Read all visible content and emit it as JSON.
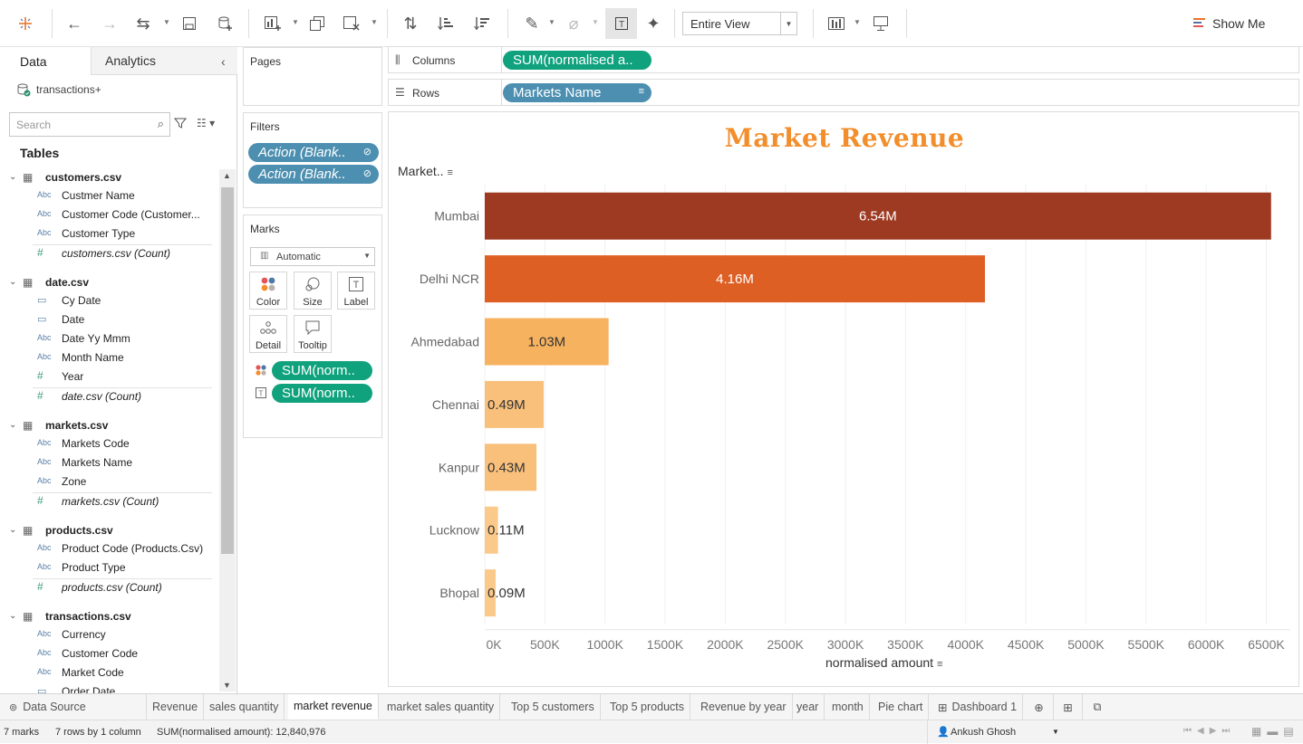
{
  "toolbar": {
    "fit": "Entire View",
    "show_me": "Show Me"
  },
  "data_pane": {
    "tabs": [
      "Data",
      "Analytics"
    ],
    "datasource": "transactions+",
    "search_placeholder": "Search",
    "tables_header": "Tables",
    "tables": [
      {
        "name": "customers.csv",
        "fields": [
          {
            "type": "Abc",
            "name": "Custmer Name"
          },
          {
            "type": "Abc",
            "name": "Customer Code (Customer..."
          },
          {
            "type": "Abc",
            "name": "Customer Type"
          },
          {
            "type": "#",
            "name": "customers.csv (Count)",
            "count": true
          }
        ]
      },
      {
        "name": "date.csv",
        "fields": [
          {
            "type": "date",
            "name": "Cy Date"
          },
          {
            "type": "date",
            "name": "Date"
          },
          {
            "type": "Abc",
            "name": "Date Yy Mmm"
          },
          {
            "type": "Abc",
            "name": "Month Name"
          },
          {
            "type": "#",
            "name": "Year"
          },
          {
            "type": "#",
            "name": "date.csv (Count)",
            "count": true
          }
        ]
      },
      {
        "name": "markets.csv",
        "fields": [
          {
            "type": "Abc",
            "name": "Markets Code"
          },
          {
            "type": "Abc",
            "name": "Markets Name"
          },
          {
            "type": "Abc",
            "name": "Zone"
          },
          {
            "type": "#",
            "name": "markets.csv (Count)",
            "count": true
          }
        ]
      },
      {
        "name": "products.csv",
        "fields": [
          {
            "type": "Abc",
            "name": "Product Code (Products.Csv)"
          },
          {
            "type": "Abc",
            "name": "Product Type"
          },
          {
            "type": "#",
            "name": "products.csv (Count)",
            "count": true
          }
        ]
      },
      {
        "name": "transactions.csv",
        "fields": [
          {
            "type": "Abc",
            "name": "Currency"
          },
          {
            "type": "Abc",
            "name": "Customer Code"
          },
          {
            "type": "Abc",
            "name": "Market Code"
          },
          {
            "type": "date",
            "name": "Order Date"
          }
        ]
      }
    ]
  },
  "cards": {
    "pages": "Pages",
    "filters": {
      "title": "Filters",
      "pills": [
        "Action (Blank..",
        "Action (Blank.."
      ]
    },
    "marks": {
      "title": "Marks",
      "type": "Automatic",
      "buttons": [
        "Color",
        "Size",
        "Label",
        "Detail",
        "Tooltip"
      ],
      "pills": [
        "SUM(norm..",
        "SUM(norm.."
      ]
    }
  },
  "shelves": {
    "columns": {
      "label": "Columns",
      "pill": "SUM(normalised a.."
    },
    "rows": {
      "label": "Rows",
      "pill": "Markets Name"
    }
  },
  "view": {
    "row_header": "Market..",
    "palette": [
      "#9e3a21",
      "#de5f24",
      "#f7b25f",
      "#f9c07b"
    ]
  },
  "chart_data": {
    "type": "bar",
    "orientation": "horizontal",
    "title": "Market Revenue",
    "xlabel": "normalised amount",
    "ylabel": "Market..",
    "categories": [
      "Mumbai",
      "Delhi NCR",
      "Ahmedabad",
      "Chennai",
      "Kanpur",
      "Lucknow",
      "Bhopal"
    ],
    "values": [
      6540000,
      4160000,
      1030000,
      490000,
      430000,
      110000,
      90000
    ],
    "data_labels": [
      "6.54M",
      "4.16M",
      "1.03M",
      "0.49M",
      "0.43M",
      "0.11M",
      "0.09M"
    ],
    "label_colors": [
      "#ffffff",
      "#ffffff",
      "#333333",
      "#333333",
      "#333333",
      "#333333",
      "#333333"
    ],
    "bar_colors": [
      "#9e3a21",
      "#de5f24",
      "#f7b25f",
      "#f9c07b",
      "#f9c07b",
      "#fbc98a",
      "#fbc98a"
    ],
    "xlim": [
      0,
      6700000
    ],
    "x_ticks": [
      0,
      500000,
      1000000,
      1500000,
      2000000,
      2500000,
      3000000,
      3500000,
      4000000,
      4500000,
      5000000,
      5500000,
      6000000,
      6500000
    ],
    "x_tick_labels": [
      "0K",
      "500K",
      "1000K",
      "1500K",
      "2000K",
      "2500K",
      "3000K",
      "3500K",
      "4000K",
      "4500K",
      "5000K",
      "5500K",
      "6000K",
      "6500K"
    ],
    "grid": true
  },
  "sheet_tabs": [
    "Data Source",
    "Revenue",
    "sales quantity",
    "market revenue",
    "market sales quantity",
    "Top 5 customers",
    "Top 5 products",
    "Revenue by year",
    "year",
    "month",
    "Pie chart",
    "Dashboard 1"
  ],
  "active_tab": "market revenue",
  "status": {
    "marks": "7 marks",
    "rows_cols": "7 rows by 1 column",
    "sum": "SUM(normalised amount): 12,840,976",
    "user": "Ankush Ghosh"
  }
}
